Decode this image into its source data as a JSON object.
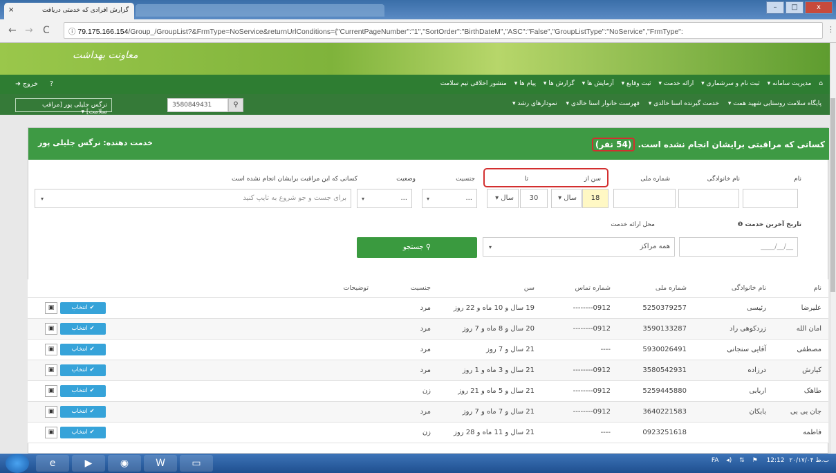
{
  "browser": {
    "tab_title": "گزارش افرادی که خدمتی دریافت",
    "tab_close": "×",
    "url_host": "79.175.166.154",
    "url_path": "/Group_/GroupList?&FrmType=NoService&returnUrlConditions={\"CurrentPageNumber\":\"1\",\"SortOrder\":\"BirthDateM\",\"ASC\":\"False\",\"GroupListType\":\"NoService\",\"FrmType\":"
  },
  "banner": {
    "logo_text": "معاونت بهداشت"
  },
  "menu1": {
    "items": [
      "مدیریت سامانه ▾",
      "ثبت نام و سرشماری ▾",
      "ارائه خدمت ▾",
      "ثبت وقایع ▾",
      "آزمایش ها ▾",
      "گزارش ها ▾",
      "پیام ها ▾",
      "منشور اخلاقی تیم سلامت"
    ],
    "exit": "خروج"
  },
  "menu2": {
    "items": [
      "پایگاه سلامت روستایی شهید همت ▾",
      "خدمت گیرنده اسنا خالدی ▾",
      "فهرست خانوار اسنا خالدی ▾",
      "نمودارهای رشد ▾"
    ],
    "user": "نرگس جلیلی پور [مراقب سلامت] ▾",
    "national_id": "3580849431"
  },
  "panel": {
    "title_prefix": "کسانی که مراقبتی برایشان انجام نشده است.",
    "count": "(54 نفر)",
    "provider": "خدمت دهنده: نرگس جلیلی پور"
  },
  "filters": {
    "name_label": "نام",
    "family_label": "نام خانوادگی",
    "nid_label": "شماره ملی",
    "age_from_label": "سن از",
    "age_to_label": "تا",
    "gender_label": "جنسیت",
    "status_label": "وضعیت",
    "not_done_label": "کسانی که این مراقبت برایشان انجام نشده است",
    "age_from_value": "18",
    "age_from_unit": "سال",
    "age_to_value": "30",
    "age_to_unit": "سال",
    "gender_value": "...",
    "status_value": "...",
    "not_done_placeholder": "برای جست و جو شروع به تایپ کنید",
    "last_service_label": "تاریخ آخرین خدمت",
    "last_service_placeholder": "__/__/____",
    "location_label": "محل ارائه خدمت",
    "location_value": "همه مراکز",
    "search_button": "جستجو"
  },
  "table": {
    "headers": [
      "نام",
      "نام خانوادگی",
      "شماره ملی",
      "شماره تماس",
      "سن",
      "جنسیت",
      "توضیحات",
      ""
    ],
    "select_label": "انتخاب",
    "rows": [
      [
        "علیرضا",
        "رئیسی",
        "5250379257",
        "0912--------",
        "19 سال و 10 ماه و 22 روز",
        "مرد"
      ],
      [
        "امان الله",
        "زردکوهی راد",
        "3590133287",
        "0912--------",
        "20 سال و 8 ماه و 7 روز",
        "مرد"
      ],
      [
        "مصطفی",
        "آقایی سنجانی",
        "5930026491",
        "----",
        "21 سال و 7 روز",
        "مرد"
      ],
      [
        "کیارش",
        "درزاده",
        "3580542931",
        "0912--------",
        "21 سال و 3 ماه و 1 روز",
        "مرد"
      ],
      [
        "طاهک",
        "اربابی",
        "5259445880",
        "0912--------",
        "21 سال و 5 ماه و 21 روز",
        "زن"
      ],
      [
        "جان بی بی",
        "بابکان",
        "3640221583",
        "0912--------",
        "21 سال و 7 ماه و 7 روز",
        "مرد"
      ],
      [
        "فاطمه",
        "",
        "0923251618",
        "----",
        "21 سال و 11 ماه و 28 روز",
        "زن"
      ]
    ]
  },
  "taskbar": {
    "lang": "FA",
    "time": "12:12",
    "ampm": "ب.ظ",
    "date": "۲۰/۱۷/۰۴"
  }
}
